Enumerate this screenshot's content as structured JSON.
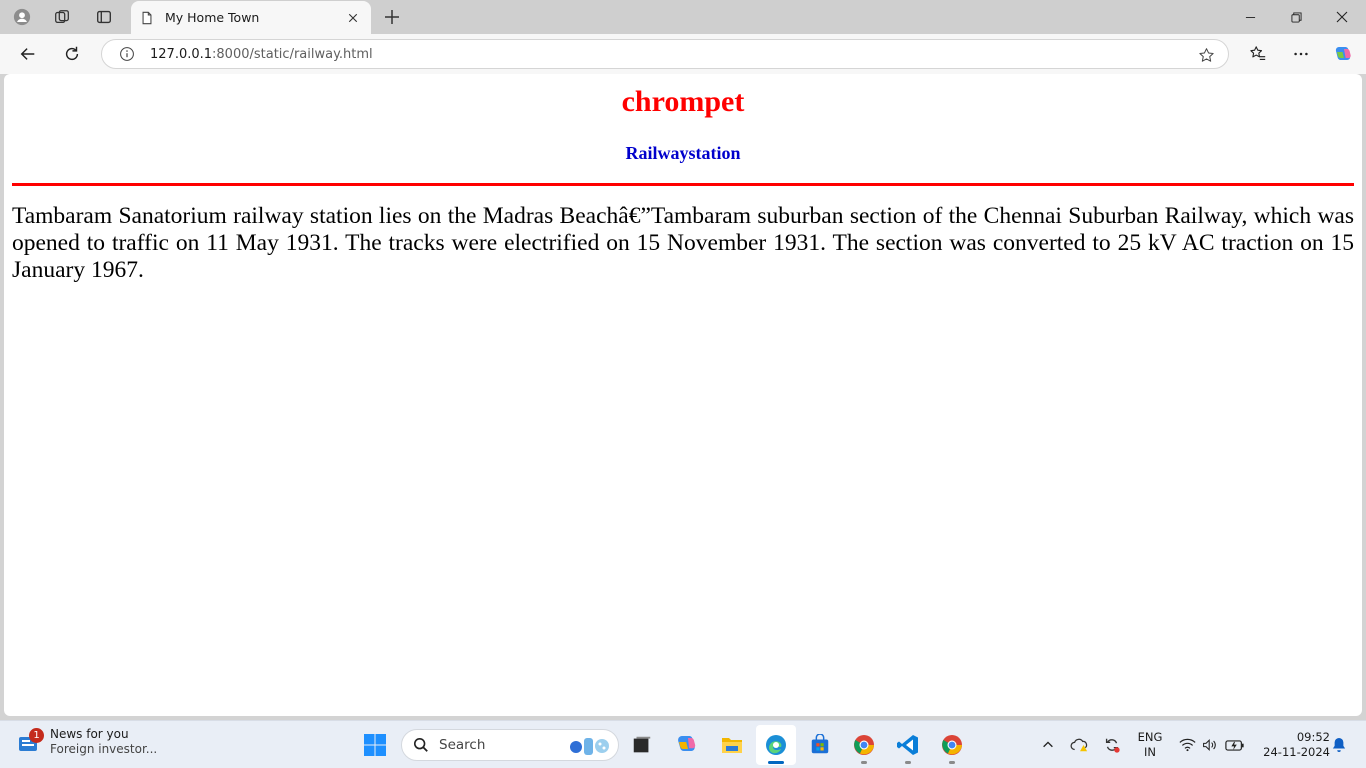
{
  "browser": {
    "tab": {
      "title": "My Home Town"
    },
    "address_bar": {
      "url_host": "127.0.0.1",
      "url_rest": ":8000/static/railway.html"
    }
  },
  "page": {
    "heading": "chrompet",
    "subheading": "Railwaystation",
    "paragraph": "Tambaram Sanatorium railway station lies on the Madras Beachâ€”Tambaram suburban section of the Chennai Suburban Railway, which was opened to traffic on 11 May 1931. The tracks were electrified on 15 November 1931. The section was converted to 25 kV AC traction on 15 January 1967.",
    "colors": {
      "heading": "#ff0000",
      "subheading": "#0000cc",
      "rule": "#ff0000"
    }
  },
  "taskbar": {
    "news": {
      "badge": "1",
      "title": "News for you",
      "subtitle": "Foreign investor..."
    },
    "search_placeholder": "Search",
    "apps": [
      "start-icon",
      "search",
      "task-view-icon",
      "copilot-icon",
      "file-explorer-icon",
      "edge-icon",
      "store-icon",
      "chrome-icon",
      "vscode-icon",
      "chrome-icon"
    ],
    "language": {
      "line1": "ENG",
      "line2": "IN"
    },
    "clock": {
      "time": "09:52",
      "date": "24-11-2024"
    }
  }
}
